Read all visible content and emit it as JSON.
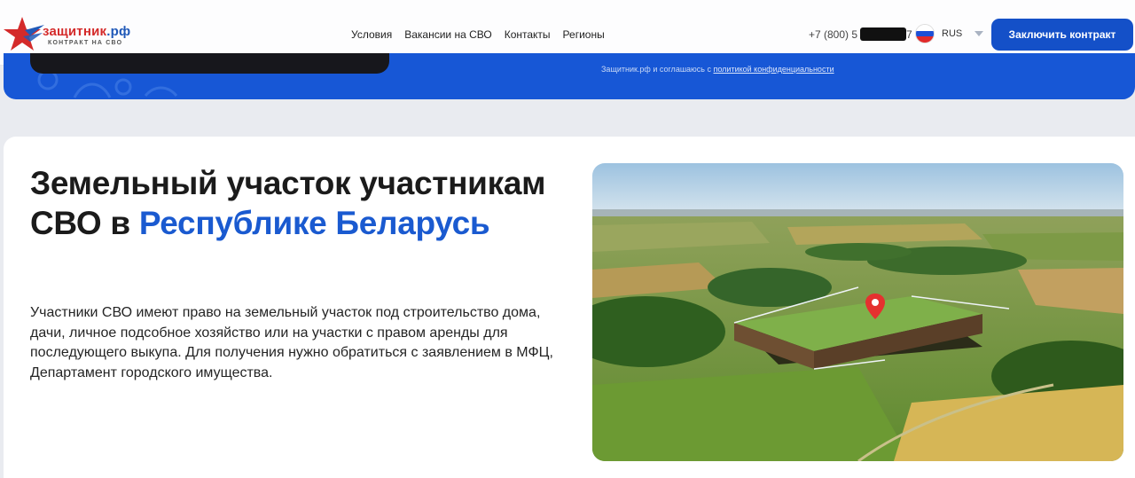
{
  "header": {
    "logo": {
      "title_part1": "защитник",
      "title_part2": ".рф",
      "subtitle": "КОНТРАКТ НА СВО"
    },
    "nav": [
      "Условия",
      "Вакансии на СВО",
      "Контакты",
      "Регионы"
    ],
    "phone_visible_start": "+7 (800) 5",
    "phone_visible_end": "7",
    "language": "RUS",
    "cta_label": "Заключить контракт"
  },
  "band": {
    "consent_text": "Защитник.рф и соглашаюсь с ",
    "consent_link": "политикой конфиденциальности"
  },
  "main": {
    "title_part1": "Земельный участок участникам СВО в ",
    "title_highlight": "Республике Беларусь",
    "description": "Участники СВО имеют право на земельный участок под строительство дома, дачи, личное подсобное хозяйство или на участки с правом аренды для последующего выкупа. Для получения нужно обратиться с заявлением в МФЦ, Департамент городского имущества."
  },
  "colors": {
    "brand_blue": "#1450c8",
    "brand_red": "#d42a2a",
    "highlight_blue": "#1a5ad0"
  },
  "icons": [
    "star-logo-icon",
    "russia-flag-icon",
    "chevron-down-icon",
    "map-pin-icon"
  ]
}
